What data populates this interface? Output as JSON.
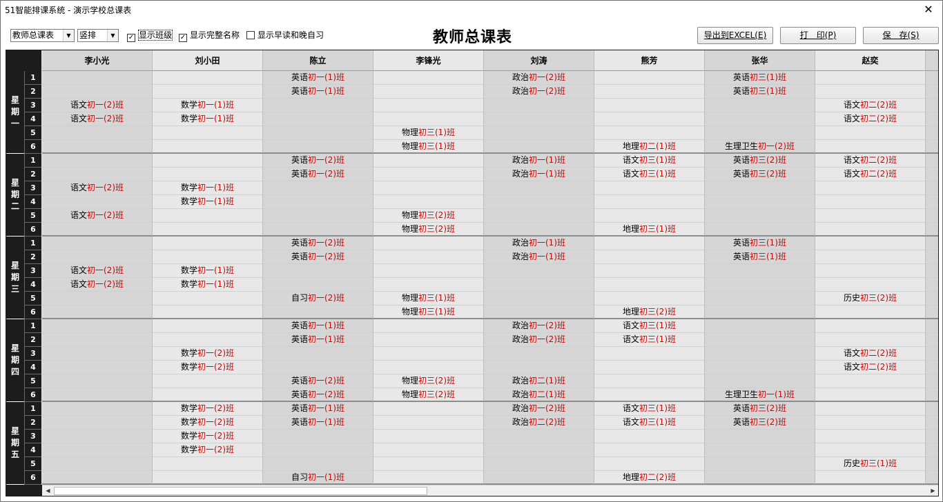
{
  "window": {
    "title": "51智能排课系统 - 演示学校总课表",
    "close_icon": "✕"
  },
  "toolbar": {
    "view_select": "教师总课表",
    "layout_select": "竖排",
    "show_class": "显示班级",
    "show_class_checked": true,
    "show_full_name": "显示完整名称",
    "show_full_name_checked": true,
    "show_early": "显示早读和晚自习",
    "show_early_checked": false,
    "page_title": "教师总课表",
    "export_button": "导出到EXCEL(E)",
    "print_button": "打　印(P)",
    "save_button": "保　存(S)"
  },
  "teachers": [
    "李小光",
    "刘小田",
    "陈立",
    "李锋光",
    "刘涛",
    "熊芳",
    "张华",
    "赵奕"
  ],
  "days": [
    {
      "label": "星期一",
      "periods": [
        "1",
        "2",
        "3",
        "4",
        "5",
        "6"
      ],
      "rows": [
        [
          [
            "",
            ""
          ],
          [
            "",
            ""
          ],
          [
            "英语",
            "初一(1)班"
          ],
          [
            "",
            ""
          ],
          [
            "政治",
            "初一(2)班"
          ],
          [
            "",
            ""
          ],
          [
            "英语",
            "初三(1)班"
          ],
          [
            "",
            ""
          ]
        ],
        [
          [
            "",
            ""
          ],
          [
            "",
            ""
          ],
          [
            "英语",
            "初一(1)班"
          ],
          [
            "",
            ""
          ],
          [
            "政治",
            "初一(2)班"
          ],
          [
            "",
            ""
          ],
          [
            "英语",
            "初三(1)班"
          ],
          [
            "",
            ""
          ]
        ],
        [
          [
            "语文",
            "初一(2)班"
          ],
          [
            "数学",
            "初一(1)班"
          ],
          [
            "",
            ""
          ],
          [
            "",
            ""
          ],
          [
            "",
            ""
          ],
          [
            "",
            ""
          ],
          [
            "",
            ""
          ],
          [
            "语文",
            "初二(2)班"
          ]
        ],
        [
          [
            "语文",
            "初一(2)班"
          ],
          [
            "数学",
            "初一(1)班"
          ],
          [
            "",
            ""
          ],
          [
            "",
            ""
          ],
          [
            "",
            ""
          ],
          [
            "",
            ""
          ],
          [
            "",
            ""
          ],
          [
            "语文",
            "初二(2)班"
          ]
        ],
        [
          [
            "",
            ""
          ],
          [
            "",
            ""
          ],
          [
            "",
            ""
          ],
          [
            "物理",
            "初三(1)班"
          ],
          [
            "",
            ""
          ],
          [
            "",
            ""
          ],
          [
            "",
            ""
          ],
          [
            "",
            ""
          ]
        ],
        [
          [
            "",
            ""
          ],
          [
            "",
            ""
          ],
          [
            "",
            ""
          ],
          [
            "物理",
            "初三(1)班"
          ],
          [
            "",
            ""
          ],
          [
            "地理",
            "初二(1)班"
          ],
          [
            "生理卫生",
            "初一(2)班"
          ],
          [
            "",
            ""
          ]
        ]
      ]
    },
    {
      "label": "星期二",
      "periods": [
        "1",
        "2",
        "3",
        "4",
        "5",
        "6"
      ],
      "rows": [
        [
          [
            "",
            ""
          ],
          [
            "",
            ""
          ],
          [
            "英语",
            "初一(2)班"
          ],
          [
            "",
            ""
          ],
          [
            "政治",
            "初一(1)班"
          ],
          [
            "语文",
            "初三(1)班"
          ],
          [
            "英语",
            "初三(2)班"
          ],
          [
            "语文",
            "初二(2)班"
          ]
        ],
        [
          [
            "",
            ""
          ],
          [
            "",
            ""
          ],
          [
            "英语",
            "初一(2)班"
          ],
          [
            "",
            ""
          ],
          [
            "政治",
            "初一(1)班"
          ],
          [
            "语文",
            "初三(1)班"
          ],
          [
            "英语",
            "初三(2)班"
          ],
          [
            "语文",
            "初二(2)班"
          ]
        ],
        [
          [
            "语文",
            "初一(2)班"
          ],
          [
            "数学",
            "初一(1)班"
          ],
          [
            "",
            ""
          ],
          [
            "",
            ""
          ],
          [
            "",
            ""
          ],
          [
            "",
            ""
          ],
          [
            "",
            ""
          ],
          [
            "",
            ""
          ]
        ],
        [
          [
            "",
            ""
          ],
          [
            "数学",
            "初一(1)班"
          ],
          [
            "",
            ""
          ],
          [
            "",
            ""
          ],
          [
            "",
            ""
          ],
          [
            "",
            ""
          ],
          [
            "",
            ""
          ],
          [
            "",
            ""
          ]
        ],
        [
          [
            "语文",
            "初一(2)班"
          ],
          [
            "",
            ""
          ],
          [
            "",
            ""
          ],
          [
            "物理",
            "初三(2)班"
          ],
          [
            "",
            ""
          ],
          [
            "",
            ""
          ],
          [
            "",
            ""
          ],
          [
            "",
            ""
          ]
        ],
        [
          [
            "",
            ""
          ],
          [
            "",
            ""
          ],
          [
            "",
            ""
          ],
          [
            "物理",
            "初三(2)班"
          ],
          [
            "",
            ""
          ],
          [
            "地理",
            "初三(1)班"
          ],
          [
            "",
            ""
          ],
          [
            "",
            ""
          ]
        ]
      ]
    },
    {
      "label": "星期三",
      "periods": [
        "1",
        "2",
        "3",
        "4",
        "5",
        "6"
      ],
      "rows": [
        [
          [
            "",
            ""
          ],
          [
            "",
            ""
          ],
          [
            "英语",
            "初一(2)班"
          ],
          [
            "",
            ""
          ],
          [
            "政治",
            "初一(1)班"
          ],
          [
            "",
            ""
          ],
          [
            "英语",
            "初三(1)班"
          ],
          [
            "",
            ""
          ]
        ],
        [
          [
            "",
            ""
          ],
          [
            "",
            ""
          ],
          [
            "英语",
            "初一(2)班"
          ],
          [
            "",
            ""
          ],
          [
            "政治",
            "初一(1)班"
          ],
          [
            "",
            ""
          ],
          [
            "英语",
            "初三(1)班"
          ],
          [
            "",
            ""
          ]
        ],
        [
          [
            "语文",
            "初一(2)班"
          ],
          [
            "数学",
            "初一(1)班"
          ],
          [
            "",
            ""
          ],
          [
            "",
            ""
          ],
          [
            "",
            ""
          ],
          [
            "",
            ""
          ],
          [
            "",
            ""
          ],
          [
            "",
            ""
          ]
        ],
        [
          [
            "语文",
            "初一(2)班"
          ],
          [
            "数学",
            "初一(1)班"
          ],
          [
            "",
            ""
          ],
          [
            "",
            ""
          ],
          [
            "",
            ""
          ],
          [
            "",
            ""
          ],
          [
            "",
            ""
          ],
          [
            "",
            ""
          ]
        ],
        [
          [
            "",
            ""
          ],
          [
            "",
            ""
          ],
          [
            "自习",
            "初一(2)班"
          ],
          [
            "物理",
            "初三(1)班"
          ],
          [
            "",
            ""
          ],
          [
            "",
            ""
          ],
          [
            "",
            ""
          ],
          [
            "历史",
            "初三(2)班"
          ]
        ],
        [
          [
            "",
            ""
          ],
          [
            "",
            ""
          ],
          [
            "",
            ""
          ],
          [
            "物理",
            "初三(1)班"
          ],
          [
            "",
            ""
          ],
          [
            "地理",
            "初三(2)班"
          ],
          [
            "",
            ""
          ],
          [
            "",
            ""
          ]
        ]
      ]
    },
    {
      "label": "星期四",
      "periods": [
        "1",
        "2",
        "3",
        "4",
        "5",
        "6"
      ],
      "rows": [
        [
          [
            "",
            ""
          ],
          [
            "",
            ""
          ],
          [
            "英语",
            "初一(1)班"
          ],
          [
            "",
            ""
          ],
          [
            "政治",
            "初一(2)班"
          ],
          [
            "语文",
            "初三(1)班"
          ],
          [
            "",
            ""
          ],
          [
            "",
            ""
          ]
        ],
        [
          [
            "",
            ""
          ],
          [
            "",
            ""
          ],
          [
            "英语",
            "初一(1)班"
          ],
          [
            "",
            ""
          ],
          [
            "政治",
            "初一(2)班"
          ],
          [
            "语文",
            "初三(1)班"
          ],
          [
            "",
            ""
          ],
          [
            "",
            ""
          ]
        ],
        [
          [
            "",
            ""
          ],
          [
            "数学",
            "初一(2)班"
          ],
          [
            "",
            ""
          ],
          [
            "",
            ""
          ],
          [
            "",
            ""
          ],
          [
            "",
            ""
          ],
          [
            "",
            ""
          ],
          [
            "语文",
            "初二(2)班"
          ]
        ],
        [
          [
            "",
            ""
          ],
          [
            "数学",
            "初一(2)班"
          ],
          [
            "",
            ""
          ],
          [
            "",
            ""
          ],
          [
            "",
            ""
          ],
          [
            "",
            ""
          ],
          [
            "",
            ""
          ],
          [
            "语文",
            "初二(2)班"
          ]
        ],
        [
          [
            "",
            ""
          ],
          [
            "",
            ""
          ],
          [
            "英语",
            "初一(2)班"
          ],
          [
            "物理",
            "初三(2)班"
          ],
          [
            "政治",
            "初二(1)班"
          ],
          [
            "",
            ""
          ],
          [
            "",
            ""
          ],
          [
            "",
            ""
          ]
        ],
        [
          [
            "",
            ""
          ],
          [
            "",
            ""
          ],
          [
            "英语",
            "初一(2)班"
          ],
          [
            "物理",
            "初三(2)班"
          ],
          [
            "政治",
            "初二(1)班"
          ],
          [
            "",
            ""
          ],
          [
            "生理卫生",
            "初一(1)班"
          ],
          [
            "",
            ""
          ]
        ]
      ]
    },
    {
      "label": "星期五",
      "periods": [
        "1",
        "2",
        "3",
        "4",
        "5",
        "6"
      ],
      "rows": [
        [
          [
            "",
            ""
          ],
          [
            "数学",
            "初一(2)班"
          ],
          [
            "英语",
            "初一(1)班"
          ],
          [
            "",
            ""
          ],
          [
            "政治",
            "初一(2)班"
          ],
          [
            "语文",
            "初三(1)班"
          ],
          [
            "英语",
            "初三(2)班"
          ],
          [
            "",
            ""
          ]
        ],
        [
          [
            "",
            ""
          ],
          [
            "数学",
            "初一(2)班"
          ],
          [
            "英语",
            "初一(1)班"
          ],
          [
            "",
            ""
          ],
          [
            "政治",
            "初二(2)班"
          ],
          [
            "语文",
            "初三(1)班"
          ],
          [
            "英语",
            "初三(2)班"
          ],
          [
            "",
            ""
          ]
        ],
        [
          [
            "",
            ""
          ],
          [
            "数学",
            "初一(2)班"
          ],
          [
            "",
            ""
          ],
          [
            "",
            ""
          ],
          [
            "",
            ""
          ],
          [
            "",
            ""
          ],
          [
            "",
            ""
          ],
          [
            "",
            ""
          ]
        ],
        [
          [
            "",
            ""
          ],
          [
            "数学",
            "初一(2)班"
          ],
          [
            "",
            ""
          ],
          [
            "",
            ""
          ],
          [
            "",
            ""
          ],
          [
            "",
            ""
          ],
          [
            "",
            ""
          ],
          [
            "",
            ""
          ]
        ],
        [
          [
            "",
            ""
          ],
          [
            "",
            ""
          ],
          [
            "",
            ""
          ],
          [
            "",
            ""
          ],
          [
            "",
            ""
          ],
          [
            "",
            ""
          ],
          [
            "",
            ""
          ],
          [
            "历史",
            "初三(1)班"
          ]
        ],
        [
          [
            "",
            ""
          ],
          [
            "",
            ""
          ],
          [
            "自习",
            "初一(1)班"
          ],
          [
            "",
            ""
          ],
          [
            "",
            ""
          ],
          [
            "地理",
            "初二(2)班"
          ],
          [
            "",
            ""
          ],
          [
            "",
            ""
          ]
        ]
      ]
    }
  ],
  "scrollbar": {
    "left_icon": "◀",
    "right_icon": "▶"
  }
}
